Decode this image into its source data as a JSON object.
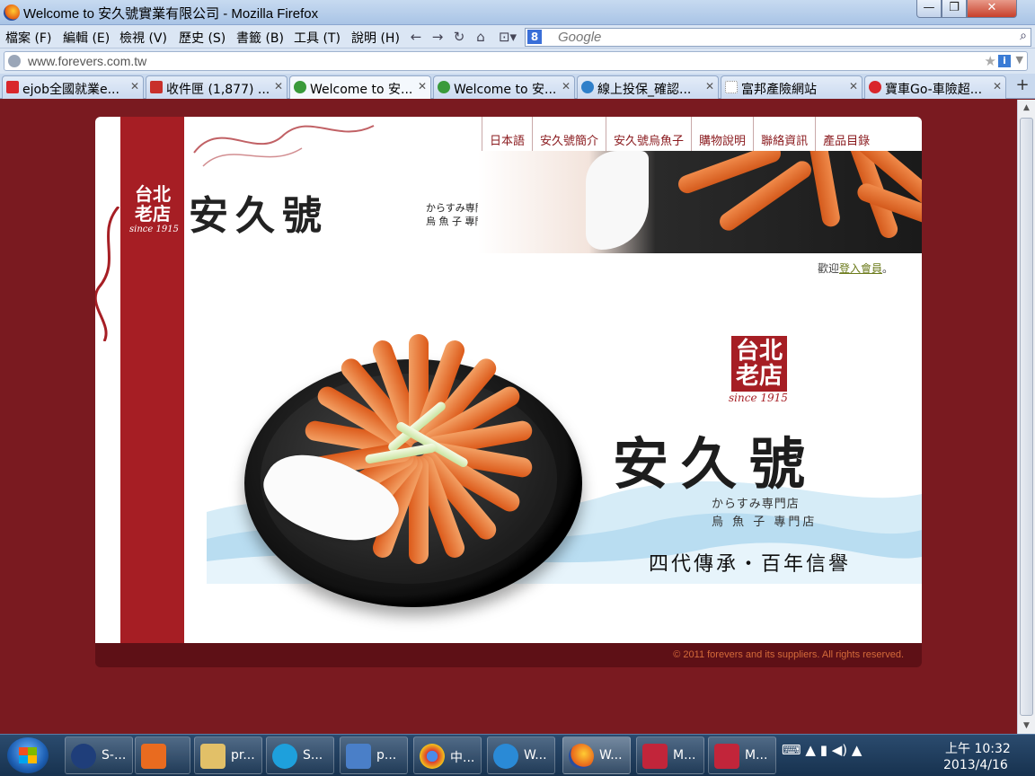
{
  "window": {
    "title": "Welcome to 安久號實業有限公司 - Mozilla Firefox",
    "min": "—",
    "max": "❐",
    "close": "✕"
  },
  "menu": [
    "檔案 (F)",
    "編輯 (E)",
    "檢視 (V)",
    "歷史 (S)",
    "書籤 (B)",
    "工具 (T)",
    "說明 (H)"
  ],
  "nav_icons": {
    "back": "back-arrow-icon",
    "forward": "forward-arrow-icon",
    "reload": "reload-icon",
    "home": "home-icon"
  },
  "search": {
    "placeholder": "Google",
    "engine_label": "8"
  },
  "address": {
    "url": "www.forevers.com.tw"
  },
  "tabs": [
    {
      "label": "ejob全國就業e...",
      "icon_color": "#d9262b"
    },
    {
      "label": "收件匣 (1,877) ...",
      "icon_color": "#c8302b"
    },
    {
      "label": "Welcome to 安...",
      "icon_color": "#3a9a3a",
      "active": true
    },
    {
      "label": "Welcome to 安...",
      "icon_color": "#3a9a3a"
    },
    {
      "label": "線上投保_確認...",
      "icon_color": "#2f7fc9"
    },
    {
      "label": "富邦產險網站",
      "icon_color": "#ffffff"
    },
    {
      "label": "寶車Go-車險超...",
      "icon_color": "#d9262b"
    }
  ],
  "site": {
    "nav": [
      "日本語",
      "安久號簡介",
      "安久號烏魚子",
      "購物說明",
      "聯絡資訊",
      "產品目錄"
    ],
    "seal_text": "台北老店",
    "since": "since 1915",
    "logo": "安久號",
    "logo_sub1": "からすみ専門店",
    "logo_sub2": "烏 魚 子 專門店",
    "welcome_prefix": "歡迎",
    "welcome_link": "登入會員",
    "welcome_suffix": "。",
    "brand_sub1": "からすみ専門店",
    "brand_sub2": "烏 魚 子 專門店",
    "slogan": "四代傳承・百年信譽",
    "copyright": "© 2011 forevers and its suppliers. All rights reserved."
  },
  "taskbar": {
    "buttons": [
      {
        "label": "S-...",
        "color": "#1f3e7a"
      },
      {
        "label": "",
        "color": "#e96b1f"
      },
      {
        "label": "pr...",
        "color": "#e2c068"
      },
      {
        "label": "S...",
        "color": "#1ea0dc"
      },
      {
        "label": "p...",
        "color": "#4a7fc8"
      },
      {
        "label": "中...",
        "color": "#db3c30"
      },
      {
        "label": "W...",
        "color": "#2a8ad6"
      },
      {
        "label": "W...",
        "color": "#e8621a",
        "active": true
      },
      {
        "label": "M...",
        "color": "#c2253a"
      },
      {
        "label": "M...",
        "color": "#c2253a"
      }
    ],
    "tray": "⌨  ▲  ▮  ◀)  ▲",
    "time": "上午 10:32",
    "date": "2013/4/16"
  }
}
